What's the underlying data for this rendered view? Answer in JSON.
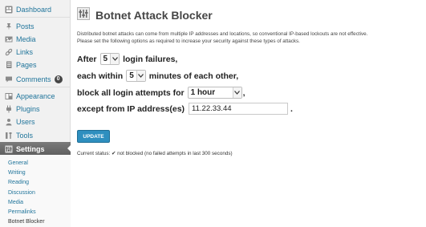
{
  "sidebar": {
    "items": [
      {
        "label": "Dashboard",
        "icon": "dashboard-icon"
      },
      {
        "label": "Posts",
        "icon": "pin-icon"
      },
      {
        "label": "Media",
        "icon": "media-icon"
      },
      {
        "label": "Links",
        "icon": "link-icon"
      },
      {
        "label": "Pages",
        "icon": "page-icon"
      },
      {
        "label": "Comments",
        "icon": "comment-icon",
        "badge": "0"
      },
      {
        "label": "Appearance",
        "icon": "appearance-icon"
      },
      {
        "label": "Plugins",
        "icon": "plugin-icon"
      },
      {
        "label": "Users",
        "icon": "users-icon"
      },
      {
        "label": "Tools",
        "icon": "tools-icon"
      },
      {
        "label": "Settings",
        "icon": "settings-icon",
        "active": true
      }
    ],
    "submenu": [
      "General",
      "Writing",
      "Reading",
      "Discussion",
      "Media",
      "Permalinks",
      "Botnet Blocker"
    ],
    "submenu_current": "Botnet Blocker"
  },
  "main": {
    "title": "Botnet Attack Blocker",
    "description_line1": "Distributed botnet attacks can come from multiple IP addresses and locations, so conventional IP-based lockouts are not effective.",
    "description_line2": "Please set the following options as required to increase your security against these types of attacks.",
    "form": {
      "row1_before": "After",
      "row1_value": "5",
      "row1_after": "login failures,",
      "row2_before": "each within",
      "row2_value": "5",
      "row2_after": "minutes of each other,",
      "row3_before": "block all login attempts for",
      "row3_value": "1 hour",
      "row3_after": ",",
      "row4_before": "except from IP address(es)",
      "row4_value": "11.22.33.44",
      "row4_after": "."
    },
    "update_label": "UPDATE",
    "status_text": "Current status: ✔ not blocked (no failed attempts in last 300 seconds)"
  },
  "colors": {
    "link": "#21759b",
    "active_menu": "#6d6d6d",
    "button": "#2e8fbf"
  }
}
